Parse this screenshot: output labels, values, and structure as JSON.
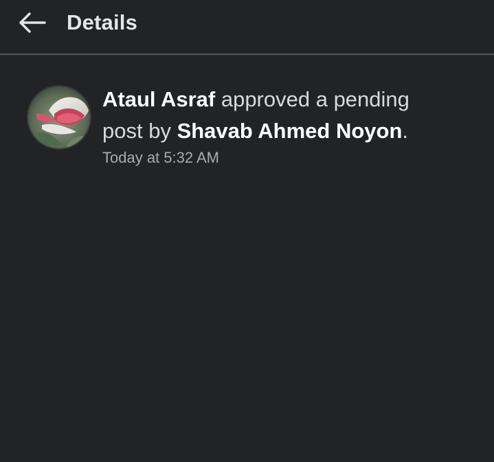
{
  "header": {
    "title": "Details"
  },
  "notification": {
    "actor": "Ataul Asraf",
    "action_part1": " approved a pending",
    "action_part2": "post by ",
    "subject": "Shavab Ahmed Noyon",
    "end_punct": ".",
    "timestamp": "Today at 5:32 AM"
  },
  "colors": {
    "background": "#222324",
    "divider": "#55575a",
    "text_primary": "#ffffff",
    "text_secondary": "#a8abaf"
  },
  "icons": {
    "back": "arrow-left-icon",
    "avatar": "flower-avatar-image"
  }
}
